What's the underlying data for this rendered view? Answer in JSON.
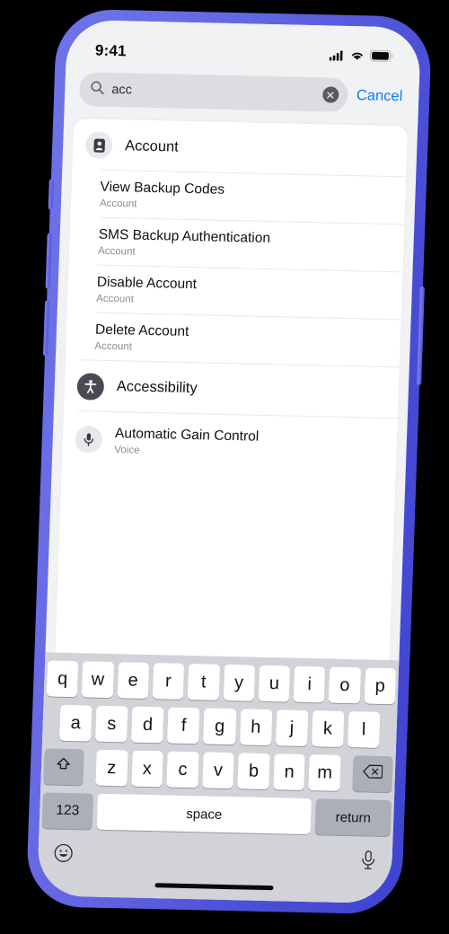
{
  "device": {
    "frame_color": "#5a5ee0",
    "screen_bg": "#f1f2f4"
  },
  "status_bar": {
    "time": "9:41",
    "cellular_icon": "signal-bars-icon",
    "wifi_icon": "wifi-icon",
    "battery_icon": "battery-icon"
  },
  "search": {
    "search_icon": "search-icon",
    "value": "acc",
    "placeholder": "Search",
    "clear_icon": "clear-circle-icon",
    "cancel_label": "Cancel",
    "cancel_color": "#0a7cff"
  },
  "results": {
    "sections": [
      {
        "icon": "contact-card-icon",
        "icon_style": "light",
        "title": "Account",
        "items": [
          {
            "title": "View Backup Codes",
            "subtitle": "Account"
          },
          {
            "title": "SMS Backup Authentication",
            "subtitle": "Account"
          },
          {
            "title": "Disable Account",
            "subtitle": "Account"
          },
          {
            "title": "Delete Account",
            "subtitle": "Account"
          }
        ]
      },
      {
        "icon": "accessibility-icon",
        "icon_style": "dark",
        "title": "Accessibility",
        "items": []
      },
      {
        "icon": "microphone-icon",
        "icon_style": "light",
        "title": "",
        "items": [
          {
            "title": "Automatic Gain Control",
            "subtitle": "Voice"
          }
        ]
      }
    ]
  },
  "keyboard": {
    "row1": [
      "q",
      "w",
      "e",
      "r",
      "t",
      "y",
      "u",
      "i",
      "o",
      "p"
    ],
    "row2": [
      "a",
      "s",
      "d",
      "f",
      "g",
      "h",
      "j",
      "k",
      "l"
    ],
    "row3": [
      "z",
      "x",
      "c",
      "v",
      "b",
      "n",
      "m"
    ],
    "shift_icon": "shift-arrow-icon",
    "backspace_icon": "backspace-icon",
    "numbers_label": "123",
    "space_label": "space",
    "return_label": "return",
    "emoji_icon": "emoji-smiley-icon",
    "dictation_icon": "microphone-icon",
    "key_bg": "#ffffff",
    "modifier_bg": "#abb0b8",
    "keyboard_bg": "#d1d3d8"
  }
}
